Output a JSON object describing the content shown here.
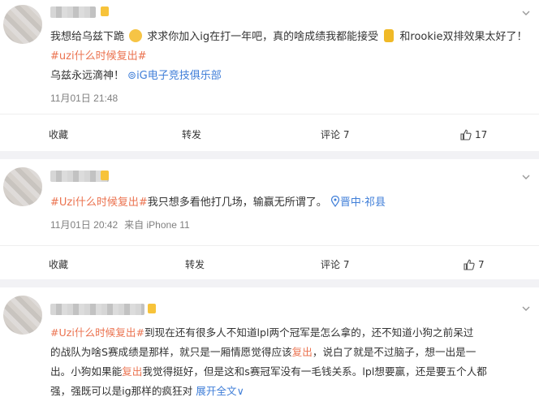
{
  "posts": [
    {
      "segments": [
        {
          "t": "我想给乌兹下跪 ",
          "c": ""
        },
        {
          "t": "",
          "c": "emoji",
          "name": "crying-emoji"
        },
        {
          "t": " 求求你加入ig在打一年吧，真的啥成绩我都能接受 ",
          "c": ""
        },
        {
          "t": "",
          "c": "trophy",
          "name": "trophy-emoji"
        },
        {
          "t": " 和rookie双排效果太好了！",
          "c": ""
        },
        {
          "t": "#uzi什么时候复出#",
          "c": "topic"
        }
      ],
      "line2_text": "乌兹永远滴神！",
      "line2_link": "iG电子竞技俱乐部",
      "time": "11月01日 21:48",
      "source": "",
      "actions": {
        "favorite": "收藏",
        "repost": "转发",
        "comment": "评论 7",
        "like": "17"
      }
    },
    {
      "topic": "#Uzi什么时候复出#",
      "text": "我只想多看他打几场，输赢无所谓了。",
      "location": "晋中·祁县",
      "time": "11月01日 20:42",
      "source": "来自 iPhone 11",
      "actions": {
        "favorite": "收藏",
        "repost": "转发",
        "comment": "评论 7",
        "like": "7"
      }
    },
    {
      "lines": [
        [
          {
            "t": "#Uzi什么时候复出#",
            "c": "topic"
          },
          {
            "t": "到现在还有很多人不知道lpl两个冠军是怎么拿的，还不知道小狗之前呆过",
            "c": ""
          }
        ],
        [
          {
            "t": "的战队为啥S赛成绩是那样，就只是一厢情愿觉得应该",
            "c": ""
          },
          {
            "t": "复出",
            "c": "topic"
          },
          {
            "t": "，说白了就是不过脑子，想一出是一",
            "c": ""
          }
        ],
        [
          {
            "t": "出。小狗如果能",
            "c": ""
          },
          {
            "t": "复出",
            "c": "topic"
          },
          {
            "t": "我觉得挺好，但是这和s赛冠军没有一毛钱关系。lpl想要赢，还是要五个人都",
            "c": ""
          }
        ],
        [
          {
            "t": "强，强既可以是ig那样的疯狂对 ",
            "c": ""
          },
          {
            "t": "展开全文",
            "c": "blue"
          },
          {
            "t": "∨",
            "c": "blue"
          }
        ]
      ]
    }
  ],
  "colors": {
    "topic": "#eb7350",
    "link": "#3f7ed8",
    "meta": "#808080",
    "divider": "#eeeeee",
    "gap": "#f2f2f5"
  }
}
